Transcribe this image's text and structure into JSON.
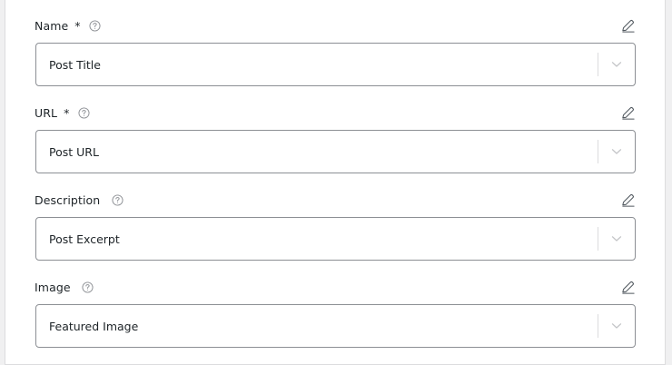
{
  "fields": [
    {
      "label": "Name",
      "required_mark": "*",
      "value": "Post Title"
    },
    {
      "label": "URL",
      "required_mark": "*",
      "value": "Post URL"
    },
    {
      "label": "Description",
      "required_mark": "",
      "value": "Post Excerpt"
    },
    {
      "label": "Image",
      "required_mark": "",
      "value": "Featured Image"
    }
  ],
  "icons": {
    "help": "question-circle-icon",
    "edit": "pencil-icon",
    "dropdown": "chevron-down-icon"
  },
  "colors": {
    "background": "#f0f0f1",
    "panel": "#ffffff",
    "border": "#8c8f94",
    "text": "#1d2327",
    "icon": "#8c8f94"
  }
}
